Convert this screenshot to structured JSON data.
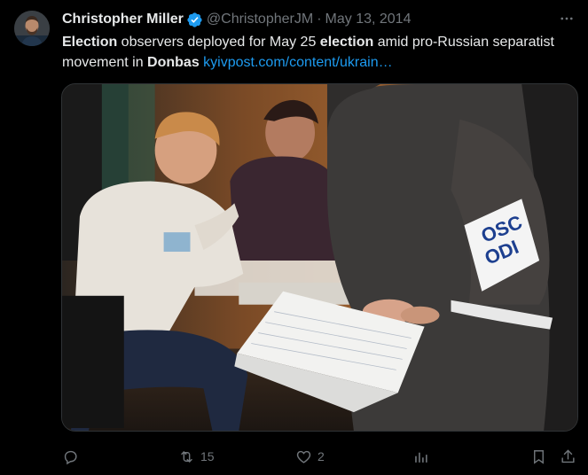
{
  "author": {
    "name": "Christopher Miller",
    "handle": "@ChristopherJM",
    "separator": "·",
    "date": "May 13, 2014",
    "verified_color": "#1d9bf0"
  },
  "tweet": {
    "part1": "Election",
    "part2": " observers deployed for May 25 ",
    "part3": "election",
    "part4": " amid pro-Russian separatist movement in ",
    "part5": "Donbas",
    "part6": " ",
    "link": "kyivpost.com/content/ukrain…"
  },
  "media": {
    "armband_line1": "OSC",
    "armband_line2": "ODI"
  },
  "actions": {
    "reply_icon": "reply-icon",
    "retweet_icon": "retweet-icon",
    "retweet_count": "15",
    "like_icon": "heart-icon",
    "like_count": "2",
    "views_icon": "views-icon",
    "bookmark_icon": "bookmark-icon",
    "share_icon": "share-icon"
  },
  "colors": {
    "background": "#000000",
    "text": "#e7e9ea",
    "muted": "#71767b",
    "link": "#1d9bf0"
  }
}
